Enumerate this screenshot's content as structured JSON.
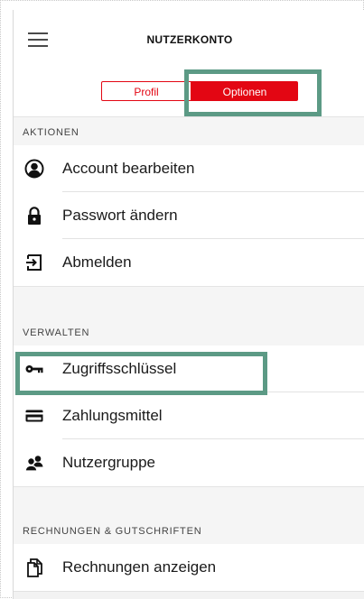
{
  "header": {
    "title": "NUTZERKONTO",
    "menu_icon": "hamburger-menu-icon"
  },
  "tabs": {
    "profil": "Profil",
    "optionen": "Optionen",
    "selected": "Optionen"
  },
  "colors": {
    "accent_red": "#e30613",
    "highlight_green": "#5c9a85"
  },
  "sections": {
    "aktionen": {
      "title": "AKTIONEN",
      "items": [
        {
          "label": "Account bearbeiten",
          "icon": "user-circle-icon"
        },
        {
          "label": "Passwort ändern",
          "icon": "lock-icon"
        },
        {
          "label": "Abmelden",
          "icon": "sign-out-icon"
        }
      ]
    },
    "verwalten": {
      "title": "VERWALTEN",
      "items": [
        {
          "label": "Zugriffsschlüssel",
          "icon": "key-icon"
        },
        {
          "label": "Zahlungsmittel",
          "icon": "credit-card-icon"
        },
        {
          "label": "Nutzergruppe",
          "icon": "user-group-icon"
        }
      ]
    },
    "rechnungen": {
      "title": "RECHNUNGEN & GUTSCHRIFTEN",
      "items": [
        {
          "label": "Rechnungen anzeigen",
          "icon": "document-icon"
        }
      ]
    }
  }
}
